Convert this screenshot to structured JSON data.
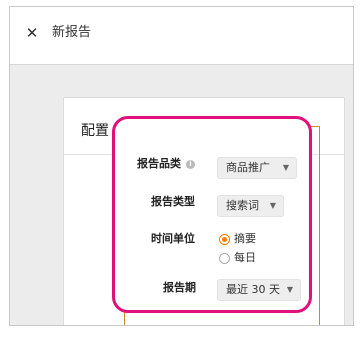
{
  "header": {
    "close_icon": "close-icon",
    "title": "新报告"
  },
  "card": {
    "title": "配置"
  },
  "form": {
    "category": {
      "label": "报告品类",
      "info_icon": "info-icon",
      "value": "商品推广"
    },
    "report_type": {
      "label": "报告类型",
      "value": "搜索词"
    },
    "time_unit": {
      "label": "时间单位",
      "options": [
        {
          "label": "摘要",
          "selected": true
        },
        {
          "label": "每日",
          "selected": false
        }
      ]
    },
    "period": {
      "label": "报告期",
      "value": "最近 30 天"
    }
  },
  "colors": {
    "highlight": "#e0107a",
    "radio_accent": "#ff7a00",
    "outline": "#c98a2e"
  }
}
